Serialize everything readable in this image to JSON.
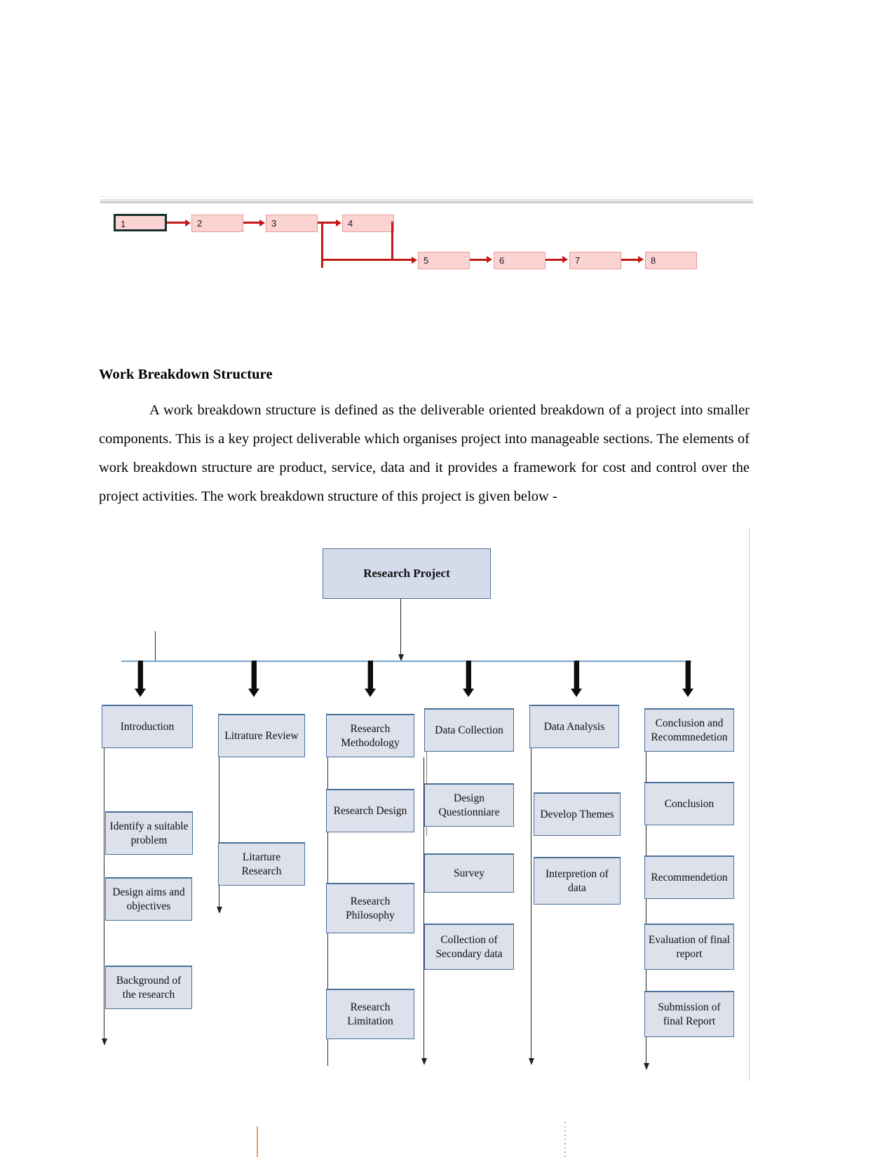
{
  "document": {
    "section_heading": "Work Breakdown Structure",
    "paragraph": "A work breakdown structure is defined as the deliverable oriented breakdown of a project into smaller components. This is a key project deliverable which organises project into manageable sections. The elements of work breakdown structure are product, service, data and it provides a framework for cost and control over the project activities. The work breakdown structure of this project is given below -"
  },
  "network_diagram": {
    "nodes": [
      {
        "label": "1",
        "selected": true
      },
      {
        "label": "2",
        "selected": false
      },
      {
        "label": "3",
        "selected": false
      },
      {
        "label": "4",
        "selected": false
      },
      {
        "label": "5",
        "selected": false
      },
      {
        "label": "6",
        "selected": false
      },
      {
        "label": "7",
        "selected": false
      },
      {
        "label": "8",
        "selected": false
      }
    ],
    "connector_color": "#c21a14",
    "node_fill": "#fbd3d3",
    "node_border": "#e89a9a",
    "selected_border": "#14302e"
  },
  "wbs": {
    "root": "Research Project",
    "box_fill": "#dce1ec",
    "box_border": "#4a7099",
    "connector_color": "#7ba3c9",
    "columns": [
      {
        "header": "Introduction",
        "children": [
          "Identify a suitable problem",
          "Design aims and objectives",
          "Background of the research"
        ]
      },
      {
        "header": "Litrature Review",
        "children": [
          "Litarture Research"
        ]
      },
      {
        "header": "Research Methodology",
        "children": [
          "Research Design",
          "Research Philosophy",
          "Research Limitation"
        ]
      },
      {
        "header": "Data Collection",
        "children": [
          "Design Questionniare",
          "Survey",
          "Collection of Secondary data"
        ]
      },
      {
        "header": "Data Analysis",
        "children": [
          "Develop Themes",
          "Interpretion of data"
        ]
      },
      {
        "header": "Conclusion and Recommnedetion",
        "children": [
          "Conclusion",
          "Recommendetion",
          "Evaluation of final report",
          "Submission of final Report"
        ]
      }
    ]
  },
  "footer_marks": {
    "orange_rule_color": "#eb9a63",
    "dotted_rule_color": "#b5b5b5"
  }
}
